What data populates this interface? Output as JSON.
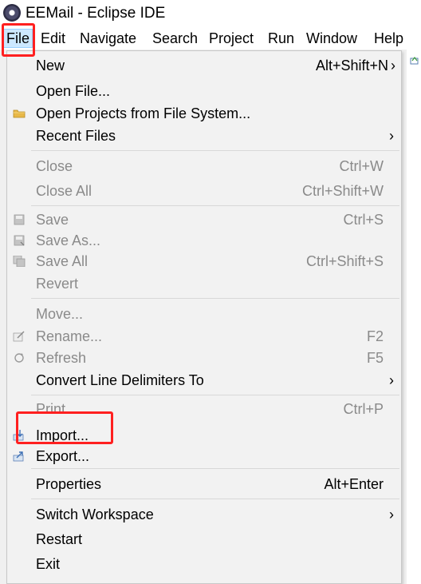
{
  "window": {
    "title": "EEMail - Eclipse IDE"
  },
  "menubar": {
    "items": [
      "File",
      "Edit",
      "Navigate",
      "Search",
      "Project",
      "Run",
      "Window",
      "Help"
    ]
  },
  "file_menu": {
    "new": {
      "label": "New",
      "shortcut": "Alt+Shift+N"
    },
    "open_file": {
      "label": "Open File..."
    },
    "open_projects": {
      "label": "Open Projects from File System..."
    },
    "recent_files": {
      "label": "Recent Files"
    },
    "close": {
      "label": "Close",
      "shortcut": "Ctrl+W"
    },
    "close_all": {
      "label": "Close All",
      "shortcut": "Ctrl+Shift+W"
    },
    "save": {
      "label": "Save",
      "shortcut": "Ctrl+S"
    },
    "save_as": {
      "label": "Save As..."
    },
    "save_all": {
      "label": "Save All",
      "shortcut": "Ctrl+Shift+S"
    },
    "revert": {
      "label": "Revert"
    },
    "move": {
      "label": "Move..."
    },
    "rename": {
      "label": "Rename...",
      "shortcut": "F2"
    },
    "refresh": {
      "label": "Refresh",
      "shortcut": "F5"
    },
    "convert": {
      "label": "Convert Line Delimiters To"
    },
    "print": {
      "label": "Print...",
      "shortcut": "Ctrl+P"
    },
    "import": {
      "label": "Import..."
    },
    "export": {
      "label": "Export..."
    },
    "properties": {
      "label": "Properties",
      "shortcut": "Alt+Enter"
    },
    "switch_workspace": {
      "label": "Switch Workspace"
    },
    "restart": {
      "label": "Restart"
    },
    "exit": {
      "label": "Exit"
    }
  },
  "colors": {
    "annotation": "#ff2020",
    "disabled_text": "#8a8a8a",
    "menu_bg": "#f2f2f2",
    "active_menu_bg": "#cce8ff"
  },
  "icons": {
    "open_projects": "folder-icon",
    "save": "save-icon",
    "save_as": "save-as-icon",
    "save_all": "save-all-icon",
    "rename": "rename-icon",
    "refresh": "refresh-icon",
    "import": "import-icon",
    "export": "export-icon",
    "submenu": "chevron-right-icon"
  }
}
